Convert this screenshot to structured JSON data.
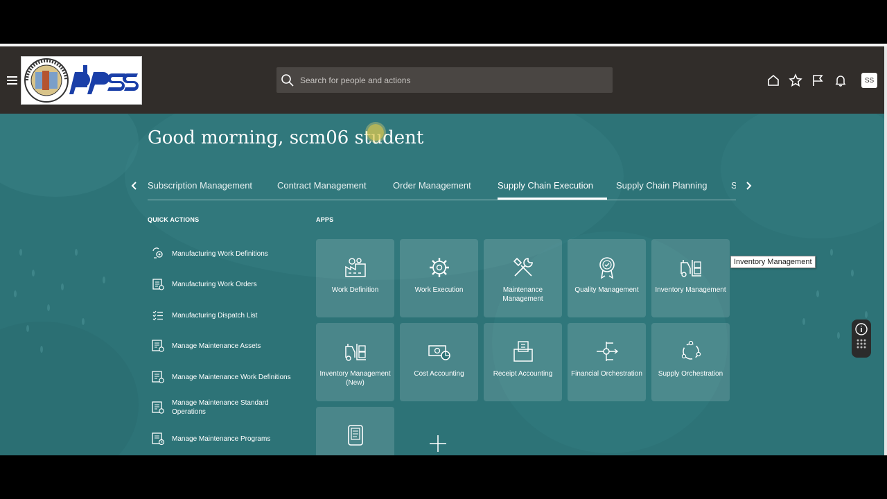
{
  "header": {
    "search_placeholder": "Search for people and actions",
    "avatar_initials": "SS",
    "logo_text": "dpss",
    "seal_text": "COUNTY OF LOS ANGELES CALIFORNIA"
  },
  "greeting": "Good morning, scm06 student",
  "tabs": [
    {
      "label": "Subscription Management"
    },
    {
      "label": "Contract Management"
    },
    {
      "label": "Order Management"
    },
    {
      "label": "Supply Chain Execution",
      "active": true
    },
    {
      "label": "Supply Chain Planning"
    },
    {
      "label": "S"
    }
  ],
  "quick_actions": {
    "title": "QUICK ACTIONS",
    "items": [
      {
        "label": "Manufacturing Work Definitions",
        "icon": "gears-icon"
      },
      {
        "label": "Manufacturing Work Orders",
        "icon": "work-order-icon"
      },
      {
        "label": "Manufacturing Dispatch List",
        "icon": "checklist-icon"
      },
      {
        "label": "Manage Maintenance Assets",
        "icon": "maintenance-doc-icon"
      },
      {
        "label": "Manage Maintenance Work Definitions",
        "icon": "maintenance-doc-icon"
      },
      {
        "label": "Manage Maintenance Standard Operations",
        "icon": "maintenance-doc-icon"
      },
      {
        "label": "Manage Maintenance Programs",
        "icon": "maintenance-clock-icon"
      }
    ]
  },
  "apps": {
    "title": "APPS",
    "tiles": [
      {
        "label": "Work Definition",
        "icon": "factory-gear-icon"
      },
      {
        "label": "Work Execution",
        "icon": "gear-icon"
      },
      {
        "label": "Maintenance Management",
        "icon": "wrench-hammer-icon"
      },
      {
        "label": "Quality Management",
        "icon": "award-ribbon-icon"
      },
      {
        "label": "Inventory Management",
        "icon": "forklift-icon"
      },
      {
        "label": "Inventory Management (New)",
        "icon": "forklift-icon"
      },
      {
        "label": "Cost Accounting",
        "icon": "money-chart-icon"
      },
      {
        "label": "Receipt Accounting",
        "icon": "box-doc-icon"
      },
      {
        "label": "Financial Orchestration",
        "icon": "orchestration-split-icon"
      },
      {
        "label": "Supply Orchestration",
        "icon": "cycle-icon"
      },
      {
        "label": "",
        "icon": "tablet-icon"
      }
    ]
  },
  "tooltip": "Inventory Management",
  "colors": {
    "header_bg": "#312d2a",
    "main_bg": "#2d7377",
    "tile_bg": "rgba(255,255,255,0.14)"
  }
}
